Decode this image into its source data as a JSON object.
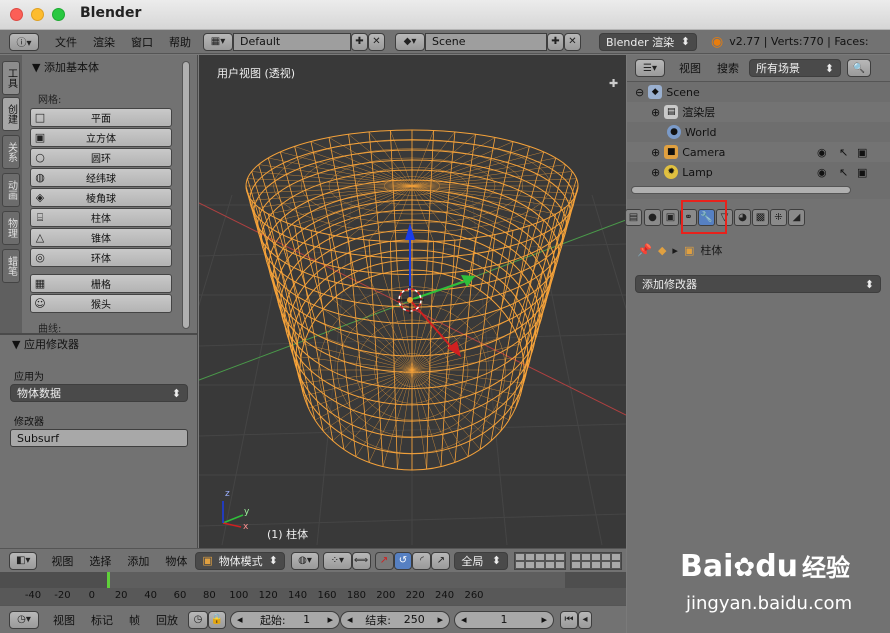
{
  "window": {
    "title": "Blender"
  },
  "topbar": {
    "menus": [
      "文件",
      "渲染",
      "窗口",
      "帮助"
    ],
    "screen_layout": "Default",
    "scene": "Scene",
    "engine": "Blender 渲染",
    "stats": "v2.77 | Verts:770 | Faces:"
  },
  "toolshelf": {
    "tabs": [
      "工具",
      "创建",
      "关系",
      "动画",
      "物理",
      "蜡笔"
    ],
    "panel_title": "▼ 添加基本体",
    "mesh_label": "网格:",
    "buttons": [
      "平面",
      "立方体",
      "圆环",
      "经纬球",
      "棱角球",
      "柱体",
      "锥体",
      "环体",
      "栅格",
      "猴头"
    ],
    "curve_label": "曲线:",
    "operator_panel_title": "▼ 应用修改器",
    "apply_as_label": "应用为",
    "apply_as_value": "物体数据",
    "modifier_label": "修改器",
    "modifier_value": "Subsurf"
  },
  "viewport": {
    "view_name": "用户视图 (透视)",
    "object_label": "(1) 柱体",
    "axis_x": "x",
    "axis_y": "y",
    "axis_z": "z"
  },
  "outliner": {
    "menu_view": "视图",
    "menu_search": "搜索",
    "filter": "所有场景",
    "items": [
      {
        "label": "Scene",
        "icon": "scene-icon",
        "indent": 0
      },
      {
        "label": "渲染层",
        "icon": "render-layers-icon",
        "indent": 1
      },
      {
        "label": "World",
        "icon": "world-icon",
        "indent": 1
      },
      {
        "label": "Camera",
        "icon": "camera-icon",
        "indent": 1
      },
      {
        "label": "Lamp",
        "icon": "lamp-icon",
        "indent": 1
      }
    ]
  },
  "properties": {
    "object_name": "柱体",
    "add_modifier": "添加修改器",
    "highlight_color": "#e8221c"
  },
  "header3d": {
    "menus": [
      "视图",
      "选择",
      "添加",
      "物体"
    ],
    "mode": "物体模式",
    "pivot": "全局"
  },
  "timeline": {
    "ticks": [
      "-40",
      "-20",
      "0",
      "20",
      "40",
      "60",
      "80",
      "100",
      "120",
      "140",
      "160",
      "180",
      "200",
      "220",
      "240",
      "260"
    ],
    "current_frame_color": "#5fd03a"
  },
  "bottombar": {
    "menus": [
      "视图",
      "标记",
      "帧",
      "回放"
    ],
    "start_label": "起始:",
    "start_value": "1",
    "end_label": "结束:",
    "end_value": "250",
    "current_value": "1"
  },
  "watermark": {
    "brand": "Bai",
    "brand2": "du",
    "cn": "经验",
    "url": "jingyan.baidu.com"
  }
}
